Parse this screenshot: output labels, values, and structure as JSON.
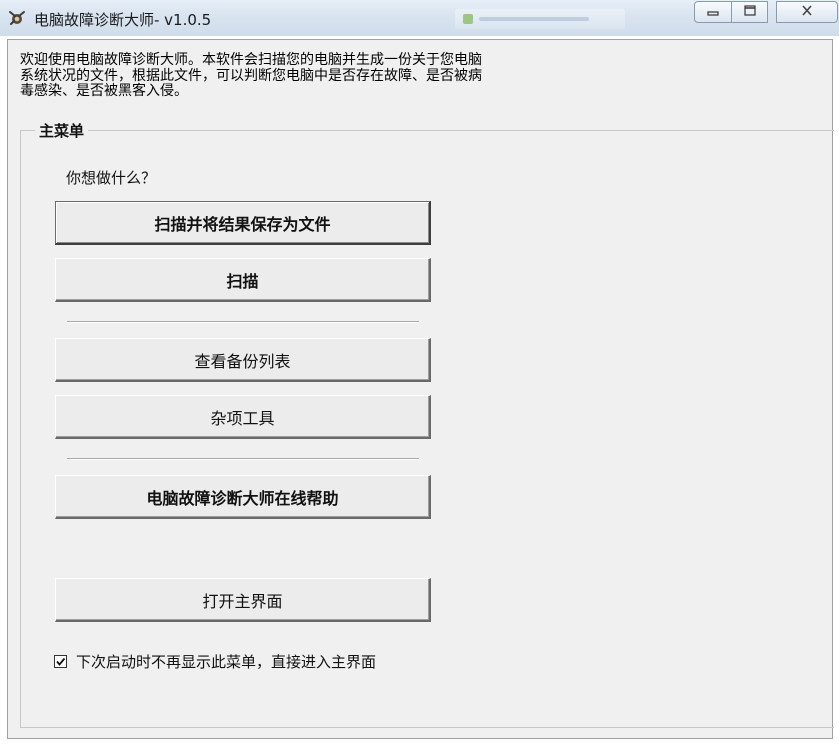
{
  "window": {
    "title": "电脑故障诊断大师- v1.0.5",
    "icon": "app-wrench-icon",
    "controls": {
      "minimize": "minimize-icon",
      "maximize": "maximize-icon",
      "close": "close-icon"
    }
  },
  "intro": {
    "line1": "欢迎使用电脑故障诊断大师。本软件会扫描您的电脑并生成一份关于您电脑",
    "line2": "系统状况的文件，根据此文件，可以判断您电脑中是否存在故障、是否被病",
    "line3": "毒感染、是否被黑客入侵。"
  },
  "menu": {
    "group_title": "主菜单",
    "question": "你想做什么？",
    "buttons": {
      "scan_save": "扫描并将结果保存为文件",
      "scan": "扫描",
      "view_backups": "查看备份列表",
      "misc_tools": "杂项工具",
      "online_help": "电脑故障诊断大师在线帮助",
      "open_main": "打开主界面"
    },
    "checkbox": {
      "label": "下次启动时不再显示此菜单，直接进入主界面",
      "checked": true
    }
  }
}
